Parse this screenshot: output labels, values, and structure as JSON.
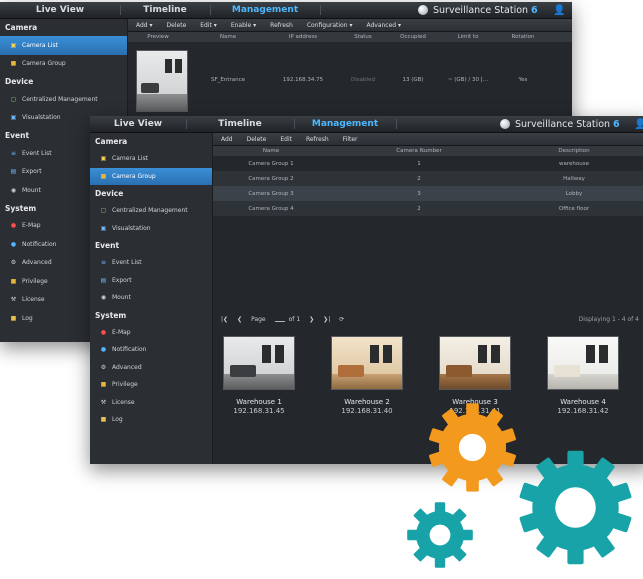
{
  "brand": {
    "name": "Surveillance Station",
    "version": "6"
  },
  "nav_tabs": [
    "Live View",
    "Timeline",
    "Management"
  ],
  "back_window": {
    "sidebar": [
      {
        "type": "head",
        "label": "Camera"
      },
      {
        "type": "item",
        "label": "Camera List",
        "icon": "camera-icon",
        "selected": true
      },
      {
        "type": "item",
        "label": "Camera Group",
        "icon": "folder-icon"
      },
      {
        "type": "head",
        "label": "Device"
      },
      {
        "type": "item",
        "label": "Centralized Management",
        "icon": "monitor-icon"
      },
      {
        "type": "item",
        "label": "Visualstation",
        "icon": "display-icon"
      },
      {
        "type": "head",
        "label": "Event"
      },
      {
        "type": "item",
        "label": "Event List",
        "icon": "list-icon"
      },
      {
        "type": "item",
        "label": "Export",
        "icon": "export-icon"
      },
      {
        "type": "item",
        "label": "Mount",
        "icon": "mount-icon"
      },
      {
        "type": "head",
        "label": "System"
      },
      {
        "type": "item",
        "label": "E-Map",
        "icon": "emap-icon"
      },
      {
        "type": "item",
        "label": "Notification",
        "icon": "notification-icon"
      },
      {
        "type": "item",
        "label": "Advanced",
        "icon": "gear-icon"
      },
      {
        "type": "item",
        "label": "Privilege",
        "icon": "lock-icon"
      },
      {
        "type": "item",
        "label": "License",
        "icon": "key-icon"
      },
      {
        "type": "item",
        "label": "Log",
        "icon": "log-icon"
      }
    ],
    "toolbar": [
      "Add",
      "Delete",
      "Edit",
      "Enable",
      "Refresh",
      "Configuration",
      "Advanced"
    ],
    "columns": [
      "Preview",
      "Name",
      "IP address",
      "Status",
      "Occupied",
      "Limit to",
      "Rotation"
    ],
    "row": {
      "name": "SF_Entrance",
      "ip": "192.168.34.75",
      "status": "Disabled",
      "occupied": "13 (GB)",
      "limit": "~ (GB) / 30 [...",
      "rotation": "Yes"
    }
  },
  "front_window": {
    "sidebar": [
      {
        "type": "head",
        "label": "Camera"
      },
      {
        "type": "item",
        "label": "Camera List",
        "icon": "camera-icon"
      },
      {
        "type": "item",
        "label": "Camera Group",
        "icon": "folder-icon",
        "selected": true
      },
      {
        "type": "head",
        "label": "Device"
      },
      {
        "type": "item",
        "label": "Centralized Management",
        "icon": "monitor-icon"
      },
      {
        "type": "item",
        "label": "Visualstation",
        "icon": "display-icon"
      },
      {
        "type": "head",
        "label": "Event"
      },
      {
        "type": "item",
        "label": "Event List",
        "icon": "list-icon"
      },
      {
        "type": "item",
        "label": "Export",
        "icon": "export-icon"
      },
      {
        "type": "item",
        "label": "Mount",
        "icon": "mount-icon"
      },
      {
        "type": "head",
        "label": "System"
      },
      {
        "type": "item",
        "label": "E-Map",
        "icon": "emap-icon"
      },
      {
        "type": "item",
        "label": "Notification",
        "icon": "notification-icon"
      },
      {
        "type": "item",
        "label": "Advanced",
        "icon": "gear-icon"
      },
      {
        "type": "item",
        "label": "Privilege",
        "icon": "lock-icon"
      },
      {
        "type": "item",
        "label": "License",
        "icon": "key-icon"
      },
      {
        "type": "item",
        "label": "Log",
        "icon": "log-icon"
      }
    ],
    "toolbar": [
      "Add",
      "Delete",
      "Edit",
      "Refresh",
      "Filter"
    ],
    "columns": [
      "Name",
      "Camera Number",
      "Description"
    ],
    "rows": [
      {
        "name": "Camera Group 1",
        "number": "1",
        "description": "warehouse"
      },
      {
        "name": "Camera Group 2",
        "number": "2",
        "description": "Hallway"
      },
      {
        "name": "Camera Group 3",
        "number": "3",
        "description": "Lobby"
      },
      {
        "name": "Camera Group 4",
        "number": "2",
        "description": "Office floor"
      }
    ],
    "pager": {
      "page_label": "Page",
      "of_label": "of 1",
      "display": "Displaying 1 - 4 of 4"
    },
    "thumbnails": [
      {
        "name": "Warehouse 1",
        "ip": "192.168.31.45",
        "style": "grey"
      },
      {
        "name": "Warehouse 2",
        "ip": "192.168.31.40",
        "style": "warm"
      },
      {
        "name": "Warehouse 3",
        "ip": "192.168.31.41",
        "style": "wood"
      },
      {
        "name": "Warehouse 4",
        "ip": "192.168.31.42",
        "style": "bright"
      }
    ]
  },
  "colors": {
    "accent": "#4db8ff",
    "gear_orange": "#f39a1e",
    "gear_teal": "#17a3a8"
  }
}
